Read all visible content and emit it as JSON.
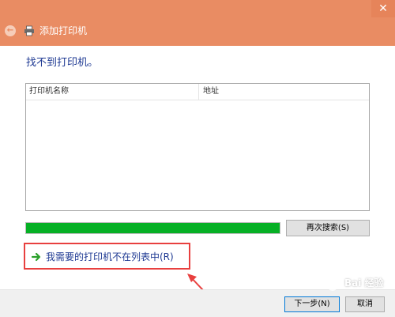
{
  "window": {
    "title": "添加打印机",
    "close_glyph": "✕",
    "back_glyph": "←",
    "accent": "#e98c63"
  },
  "main": {
    "heading": "找不到打印机。",
    "list": {
      "columns": [
        "打印机名称",
        "地址"
      ],
      "rows": []
    },
    "progress": {
      "fraction": 1.0,
      "color": "#06b025"
    },
    "search_button": "再次搜索(S)",
    "missing_link": "我需要的打印机不在列表中(R)"
  },
  "footer": {
    "next_button": "下一步(N)",
    "cancel_button": "取消"
  },
  "annotation": {
    "color": "#e8403f"
  },
  "watermark": {
    "text": "Bai 经验"
  }
}
